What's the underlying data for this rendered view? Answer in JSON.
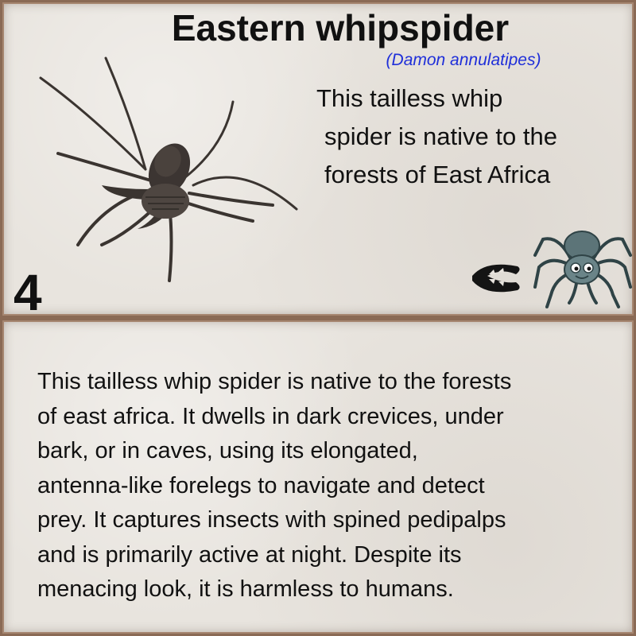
{
  "card": {
    "title": "Eastern whipspider",
    "scientific_name": "(Damon annulatipes)",
    "blurb_lines": [
      "This tailless whip",
      "spider is native to the",
      "forests of East Africa"
    ],
    "number": "4",
    "icons": [
      "spider-photo",
      "pedipalp-claw-icon",
      "cartoon-spider-mascot"
    ]
  },
  "description": {
    "lines": [
      "This tailless whip spider is native to the forests",
      "of east africa. It dwells in dark crevices, under",
      "bark, or in caves, using its elongated,",
      "antenna-like forelegs to navigate and detect",
      "prey. It captures insects with spined pedipalps",
      "and is primarily active at night. Despite its",
      "menacing look, it is harmless to humans."
    ]
  },
  "colors": {
    "frame": "#8a6a55",
    "paper": "#e8e4de",
    "scientific_name": "#1f2fd9",
    "text": "#111111"
  }
}
